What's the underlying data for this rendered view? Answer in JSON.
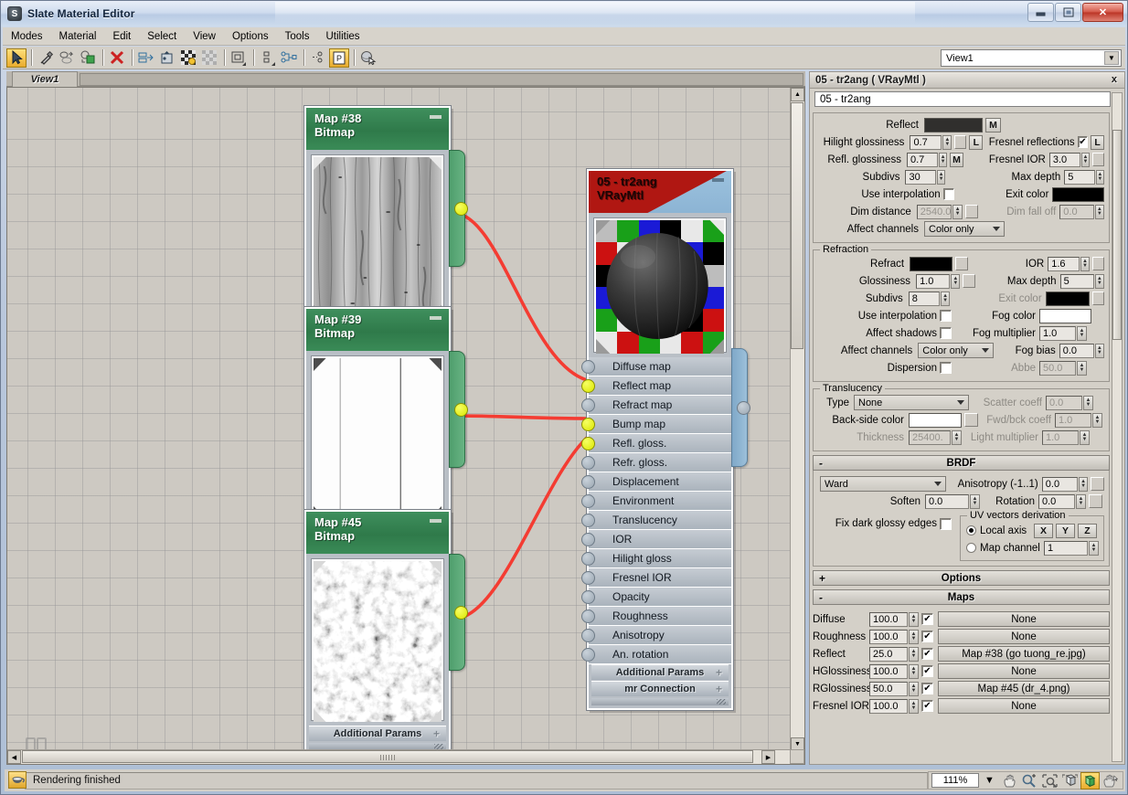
{
  "window": {
    "title": "Slate Material Editor",
    "app_icon": "max-logo-icon",
    "minimize": "–",
    "maximize": "❐",
    "close": "✕"
  },
  "menu": [
    "Modes",
    "Material",
    "Edit",
    "Select",
    "View",
    "Options",
    "Tools",
    "Utilities"
  ],
  "toolbar": {
    "items": [
      {
        "name": "select-tool",
        "icon": "arrow-cursor-icon",
        "active": true
      },
      {
        "name": "pick-material-tool",
        "icon": "eyedropper-icon",
        "active": false
      },
      {
        "name": "assign-material-tool",
        "icon": "assign-icon",
        "active": false
      },
      {
        "name": "show-in-viewport-tool",
        "icon": "material-sphere-box-icon",
        "active": false
      },
      {
        "name": "delete-tool",
        "icon": "red-x-icon",
        "active": false
      },
      {
        "name": "move-children-tool",
        "icon": "move-children-icon",
        "active": false
      },
      {
        "name": "put-material-to-library-tool",
        "icon": "library-icon",
        "active": false
      },
      {
        "name": "show-background-tool",
        "icon": "checker-background-icon",
        "active": false
      },
      {
        "name": "show-end-result-tool",
        "icon": "checker-grey-icon",
        "active": false
      },
      {
        "name": "make-preview-tool",
        "icon": "preview-square-icon",
        "active": false
      },
      {
        "name": "select-by-material-tool",
        "icon": "two-squares-icon",
        "active": false
      },
      {
        "name": "material-id-channel-tool",
        "icon": "node-tree-icon",
        "active": false
      },
      {
        "name": "layout-children-tool",
        "icon": "dots-tree-icon",
        "active": false
      },
      {
        "name": "parameter-editor-tool",
        "icon": "p-panel-icon",
        "active": true
      },
      {
        "name": "select-object-tool",
        "icon": "sphere-cursor-icon",
        "active": false
      }
    ],
    "view_selector": "View1",
    "view_selector_icon": "chevron-down-icon"
  },
  "view_tab": {
    "label": "View1"
  },
  "nodes": [
    {
      "id": "map38",
      "title": "Map #38",
      "subtitle": "Bitmap",
      "kind": "map",
      "thumbnail": "wood-grain-grayscale-texture",
      "footer": "Additional Params",
      "collapse_icon": "minimize-icon",
      "output_socket": "connected"
    },
    {
      "id": "map39",
      "title": "Map #39",
      "subtitle": "Bitmap",
      "kind": "map",
      "thumbnail": "white-vertical-lines-texture",
      "footer": "Additional Params",
      "collapse_icon": "minimize-icon",
      "output_socket": "connected"
    },
    {
      "id": "map45",
      "title": "Map #45",
      "subtitle": "Bitmap",
      "kind": "map",
      "thumbnail": "black-white-noise-texture",
      "footer": "Additional Params",
      "collapse_icon": "minimize-icon",
      "output_socket": "connected"
    },
    {
      "id": "vraymtl",
      "title": "05 - tr2ang",
      "subtitle": "VRayMtl",
      "kind": "material",
      "thumbnail": "dark-sphere-on-rgb-checker",
      "collapse_icon": "minimize-icon",
      "sockets": [
        {
          "label": "Diffuse map",
          "connected": false
        },
        {
          "label": "Reflect map",
          "connected": true
        },
        {
          "label": "Refract map",
          "connected": false
        },
        {
          "label": "Bump map",
          "connected": true
        },
        {
          "label": "Refl. gloss.",
          "connected": true
        },
        {
          "label": "Refr. gloss.",
          "connected": false
        },
        {
          "label": "Displacement",
          "connected": false
        },
        {
          "label": "Environment",
          "connected": false
        },
        {
          "label": "Translucency",
          "connected": false
        },
        {
          "label": "IOR",
          "connected": false
        },
        {
          "label": "Hilight gloss",
          "connected": false
        },
        {
          "label": "Fresnel IOR",
          "connected": false
        },
        {
          "label": "Opacity",
          "connected": false
        },
        {
          "label": "Roughness",
          "connected": false
        },
        {
          "label": "Anisotropy",
          "connected": false
        },
        {
          "label": "An. rotation",
          "connected": false
        }
      ],
      "footers": [
        "Additional Params",
        "mr Connection"
      ]
    }
  ],
  "wire_color": "#f43c32",
  "panel": {
    "title": "05 - tr2ang  ( VRayMtl )",
    "close_icon": "close-icon",
    "material_name": "05 - tr2ang",
    "reflection": {
      "reflect_label": "Reflect",
      "reflect_color": "#302f2d",
      "reflect_map_button": "M",
      "hilight_glossiness_label": "Hilight glossiness",
      "hilight_glossiness": "0.7",
      "hilight_lock_button": "L",
      "refl_glossiness_label": "Refl. glossiness",
      "refl_glossiness": "0.7",
      "refl_glossiness_map_button": "M",
      "subdivs_label": "Subdivs",
      "subdivs": "30",
      "use_interpolation_label": "Use interpolation",
      "use_interpolation_checked": false,
      "dim_distance_label": "Dim distance",
      "dim_distance": "2540.0",
      "affect_channels_label": "Affect channels",
      "affect_channels": "Color only",
      "fresnel_reflections_label": "Fresnel reflections",
      "fresnel_reflections_checked": true,
      "fresnel_lock_button": "L",
      "fresnel_ior_label": "Fresnel IOR",
      "fresnel_ior": "3.0",
      "max_depth_label": "Max depth",
      "max_depth": "5",
      "exit_color_label": "Exit color",
      "exit_color": "#000000",
      "dim_falloff_label": "Dim fall off",
      "dim_falloff": "0.0"
    },
    "refraction": {
      "group_label": "Refraction",
      "refract_label": "Refract",
      "refract_color": "#000000",
      "glossiness_label": "Glossiness",
      "glossiness": "1.0",
      "subdivs_label": "Subdivs",
      "subdivs": "8",
      "use_interpolation_label": "Use interpolation",
      "use_interpolation_checked": false,
      "affect_shadows_label": "Affect shadows",
      "affect_shadows_checked": false,
      "affect_channels_label": "Affect channels",
      "affect_channels": "Color only",
      "dispersion_label": "Dispersion",
      "dispersion_checked": false,
      "ior_label": "IOR",
      "ior": "1.6",
      "max_depth_label": "Max depth",
      "max_depth": "5",
      "exit_color_label": "Exit color",
      "exit_color": "#000000",
      "fog_color_label": "Fog color",
      "fog_color": "#ffffff",
      "fog_multiplier_label": "Fog multiplier",
      "fog_multiplier": "1.0",
      "fog_bias_label": "Fog bias",
      "fog_bias": "0.0",
      "abbe_label": "Abbe",
      "abbe": "50.0"
    },
    "translucency": {
      "group_label": "Translucency",
      "type_label": "Type",
      "type": "None",
      "back_side_color_label": "Back-side color",
      "back_side_color": "#ffffff",
      "thickness_label": "Thickness",
      "thickness": "25400.",
      "scatter_coeff_label": "Scatter coeff",
      "scatter_coeff": "0.0",
      "fwd_bck_coeff_label": "Fwd/bck coeff",
      "fwd_bck_coeff": "1.0",
      "light_multiplier_label": "Light multiplier",
      "light_multiplier": "1.0"
    },
    "brdf": {
      "rollout_label": "BRDF",
      "rollout_state": "-",
      "model": "Ward",
      "soften_label": "Soften",
      "soften": "0.0",
      "fix_dark_glossy_edges_label": "Fix dark glossy edges",
      "fix_dark_glossy_edges_checked": false,
      "anisotropy_label": "Anisotropy (-1..1)",
      "anisotropy": "0.0",
      "rotation_label": "Rotation",
      "rotation": "0.0",
      "uv_group_label": "UV vectors derivation",
      "local_axis_label": "Local axis",
      "local_axis_selected": true,
      "axis_x": "X",
      "axis_y": "Y",
      "axis_z": "Z",
      "map_channel_label": "Map channel",
      "map_channel_selected": false,
      "map_channel": "1"
    },
    "options_rollout": {
      "label": "Options",
      "state": "+"
    },
    "maps_rollout": {
      "label": "Maps",
      "state": "-"
    },
    "maps": [
      {
        "label": "Diffuse",
        "amount": "100.0",
        "enabled": true,
        "map": "None"
      },
      {
        "label": "Roughness",
        "amount": "100.0",
        "enabled": true,
        "map": "None"
      },
      {
        "label": "Reflect",
        "amount": "25.0",
        "enabled": true,
        "map": "Map #38 (go tuong_re.jpg)"
      },
      {
        "label": "HGlossiness",
        "amount": "100.0",
        "enabled": true,
        "map": "None"
      },
      {
        "label": "RGlossiness",
        "amount": "50.0",
        "enabled": true,
        "map": "Map #45 (dr_4.png)"
      },
      {
        "label": "Fresnel IOR",
        "amount": "100.0",
        "enabled": true,
        "map": "None"
      }
    ]
  },
  "statusbar": {
    "icon": "render-teapot-icon",
    "message": "Rendering finished",
    "zoom": "111%",
    "zoom_arrow_icon": "chevron-down-icon",
    "tools": [
      {
        "name": "pan-view-button",
        "icon": "hand-icon",
        "active": false
      },
      {
        "name": "zoom-button",
        "icon": "magnifier-plusminus-icon",
        "active": false
      },
      {
        "name": "zoom-region-button",
        "icon": "zoom-region-icon",
        "active": false
      },
      {
        "name": "zoom-extents-button",
        "icon": "zoom-extents-icon",
        "active": false
      },
      {
        "name": "zoom-extents-selected-button",
        "icon": "zoom-extents-selected-icon",
        "active": true
      },
      {
        "name": "pan-tool-button",
        "icon": "hand-grab-icon",
        "active": false
      }
    ]
  },
  "navigator": {
    "icon": "navigator-thumbnails-icon"
  }
}
